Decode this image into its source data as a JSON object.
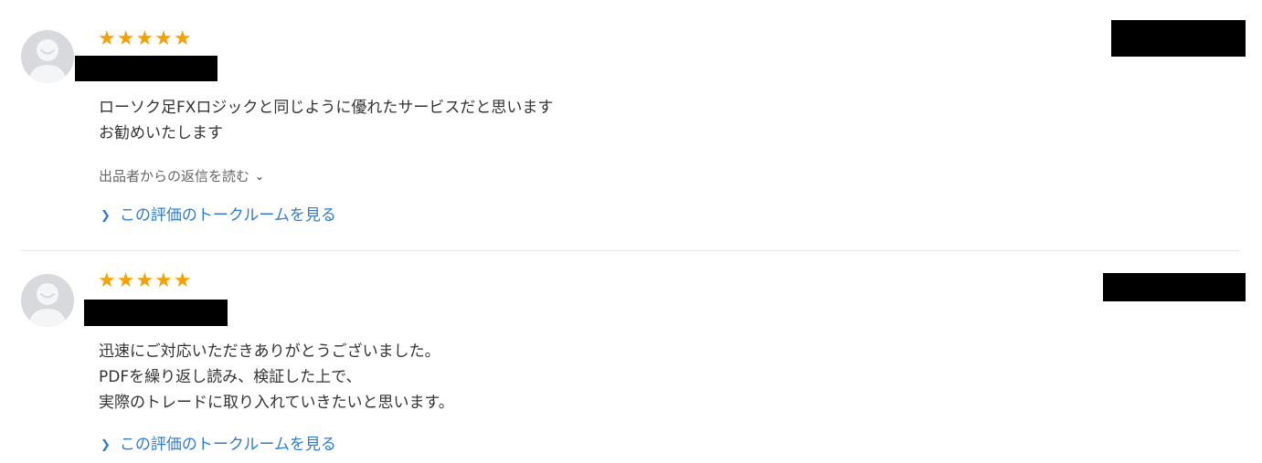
{
  "reviews": [
    {
      "stars": "★★★★★",
      "body_lines": [
        "ローソク足FXロジックと同じように優れたサービスだと思います",
        "お勧めいたします"
      ],
      "reply_label": "出品者からの返信を読む",
      "talk_label": "この評価のトークルームを見る"
    },
    {
      "stars": "★★★★★",
      "body_lines": [
        "迅速にご対応いただきありがとうございました。",
        "PDFを繰り返し読み、検証した上で、",
        "実際のトレードに取り入れていきたいと思います。"
      ],
      "talk_label": "この評価のトークルームを見る"
    }
  ],
  "colors": {
    "star": "#f5a200",
    "link": "#2c7bd6",
    "text": "#333333",
    "muted": "#666666",
    "avatar_bg": "#d7d9dc"
  },
  "icons": {
    "avatar": "user-avatar-icon",
    "reply_toggle": "chevron-down-icon",
    "talk_link": "chevron-right-icon"
  }
}
